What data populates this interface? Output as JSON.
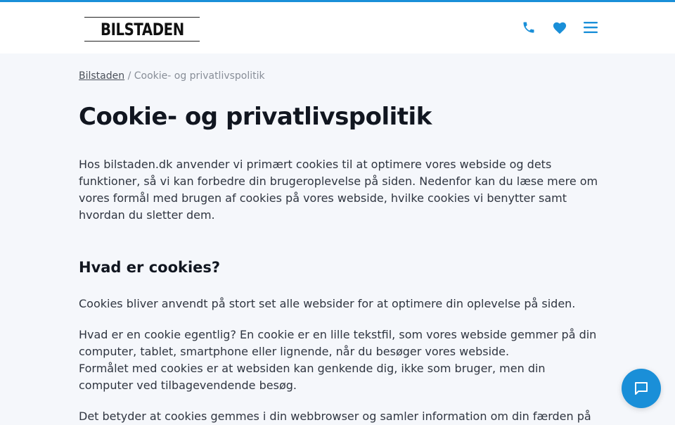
{
  "header": {
    "logo_text": "BILSTADEN",
    "icons": [
      "phone-icon",
      "heart-icon",
      "menu-icon"
    ],
    "accent_color": "#1a8fd8"
  },
  "breadcrumb": {
    "home": "Bilstaden",
    "separator": " / ",
    "current": "Cookie- og privatlivspolitik"
  },
  "page": {
    "title": "Cookie- og privatlivspolitik",
    "intro": "Hos bilstaden.dk anvender vi primært cookies til at optimere vores webside og dets funktioner, så vi kan forbedre din brugeroplevelse på siden. Nedenfor kan du læse mere om vores formål med brugen af cookies på vores webside, hvilke cookies vi benytter samt hvordan du sletter dem.",
    "section_heading": "Hvad er cookies?",
    "para1": "Cookies bliver anvendt på stort set alle websider for at optimere din oplevelse på siden.",
    "para2a": "Hvad er en cookie egentlig? En cookie er en lille tekstfil, som vores webside gemmer på din computer, tablet, smartphone eller lignende, når du besøger vores webside.",
    "para2b": "Formålet med cookies er at websiden kan genkende dig, ikke som bruger, men din computer ved tilbagevendende besøg.",
    "para3": "Det betyder at cookies gemmes i din webbrowser og samler information om din færden på"
  },
  "chat": {
    "icon": "chat-bubble-icon"
  }
}
